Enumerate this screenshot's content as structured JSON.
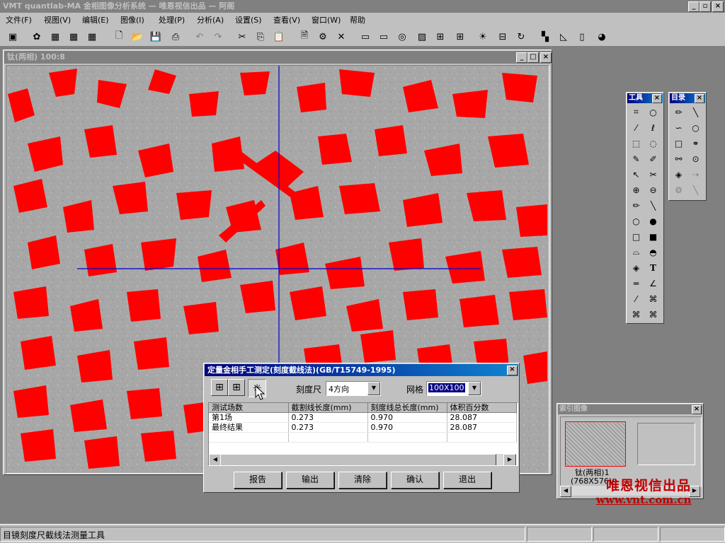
{
  "app": {
    "title": "VMT quantlab-MA 金相图像分析系统 — 唯恩视信出品 — 阿阁"
  },
  "menu": [
    {
      "label": "文件(F)"
    },
    {
      "label": "视图(V)"
    },
    {
      "label": "编辑(E)"
    },
    {
      "label": "图像(I)"
    },
    {
      "label": "处理(P)"
    },
    {
      "label": "分析(A)"
    },
    {
      "label": "设置(S)"
    },
    {
      "label": "查看(V)"
    },
    {
      "label": "窗口(W)"
    },
    {
      "label": "帮助"
    }
  ],
  "image_window": {
    "title": "钛(两相)  100:8"
  },
  "dialog": {
    "title": "定量金相手工测定(刻度截线法)(GB/T15749-1995)",
    "scale_label": "刻度尺",
    "scale_value": "4方向",
    "grid_label": "网格",
    "grid_value": "100X100",
    "columns": [
      "测试场数",
      "截割线长度(mm)",
      "刻度线总长度(mm)",
      "体积百分数"
    ],
    "rows": [
      [
        "第1场",
        "0.273",
        "0.970",
        "28.087"
      ],
      [
        "最终结果",
        "0.273",
        "0.970",
        "28.087"
      ]
    ],
    "buttons": {
      "report": "报告",
      "export": "输出",
      "clear": "清除",
      "confirm": "确认",
      "exit": "退出"
    }
  },
  "thumb_panel": {
    "title": "索引图像",
    "caption": "钛(两相)1",
    "size": "(768X576)"
  },
  "tools_panel": {
    "title": "工具"
  },
  "draw_panel": {
    "title": "目录"
  },
  "watermark": {
    "line1": "唯恩视信出品",
    "line2": "www.vnt.com.cn"
  },
  "status": {
    "text": "目镜刻度尺截线法测量工具"
  },
  "colors": {
    "accent": "#000080",
    "phase": "#ff0000",
    "watermark": "#c00000"
  }
}
